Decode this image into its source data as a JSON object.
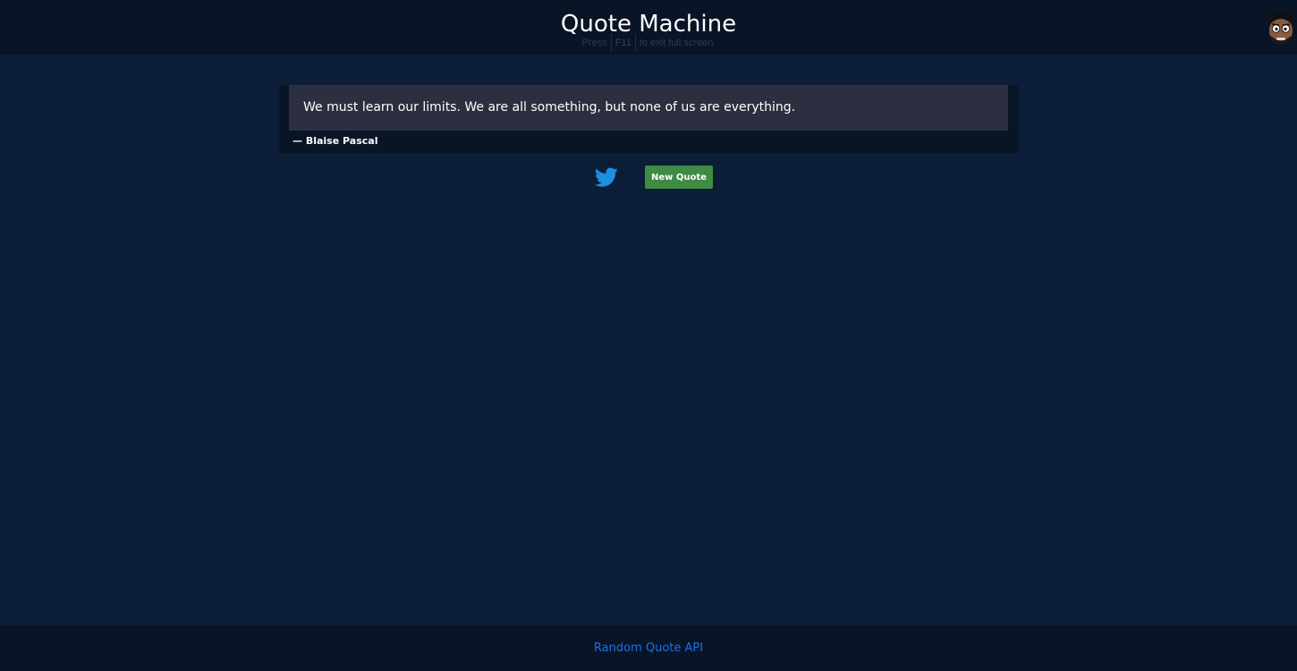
{
  "header": {
    "title": "Quote Machine",
    "fullscreen_hint": {
      "prefix": "Press",
      "key": "F11",
      "suffix": "to exit full screen"
    },
    "avatar_icon": "cartoon-face-avatar-icon"
  },
  "quote": {
    "text": "We must learn our limits. We are all something, but none of us are everything.",
    "author": "— Blaise Pascal"
  },
  "actions": {
    "tweet_icon": "twitter-bird-icon",
    "new_quote_label": "New Quote"
  },
  "footer": {
    "link_text": "Random Quote API"
  },
  "colors": {
    "background": "#0c1d37",
    "header_footer": "#091427",
    "quote_box": "#2c2f3f",
    "button_green": "#3f8b43",
    "twitter_blue": "#1d8fe1",
    "link_blue": "#1a73e8"
  }
}
